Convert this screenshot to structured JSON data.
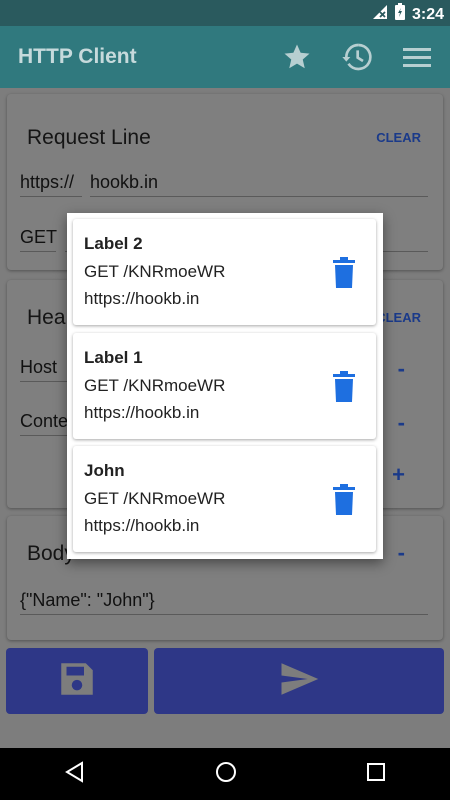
{
  "status": {
    "time": "3:24"
  },
  "appbar": {
    "title": "HTTP Client",
    "icons": [
      "star-icon",
      "history-icon",
      "menu-icon"
    ]
  },
  "request_line": {
    "title": "Request Line",
    "clear": "CLEAR",
    "scheme": "https://",
    "host": "hookb.in",
    "method": "GET"
  },
  "headers": {
    "title": "Hea",
    "clear": "CLEAR",
    "rows": [
      {
        "name": "Host",
        "remove": "-"
      },
      {
        "name": "Conte",
        "remove": "-"
      }
    ],
    "add": "+"
  },
  "body": {
    "title": "Body",
    "remove": "-",
    "value": "{\"Name\": \"John\"}"
  },
  "history": [
    {
      "label": "Label 2",
      "request": "GET /KNRmoeWR",
      "url": "https://hookb.in"
    },
    {
      "label": "Label 1",
      "request": "GET /KNRmoeWR",
      "url": "https://hookb.in"
    },
    {
      "label": "John",
      "request": "GET /KNRmoeWR",
      "url": "https://hookb.in"
    }
  ],
  "colors": {
    "accent": "#1e6fe0",
    "appbar": "#30797e",
    "button": "#2e3787"
  }
}
